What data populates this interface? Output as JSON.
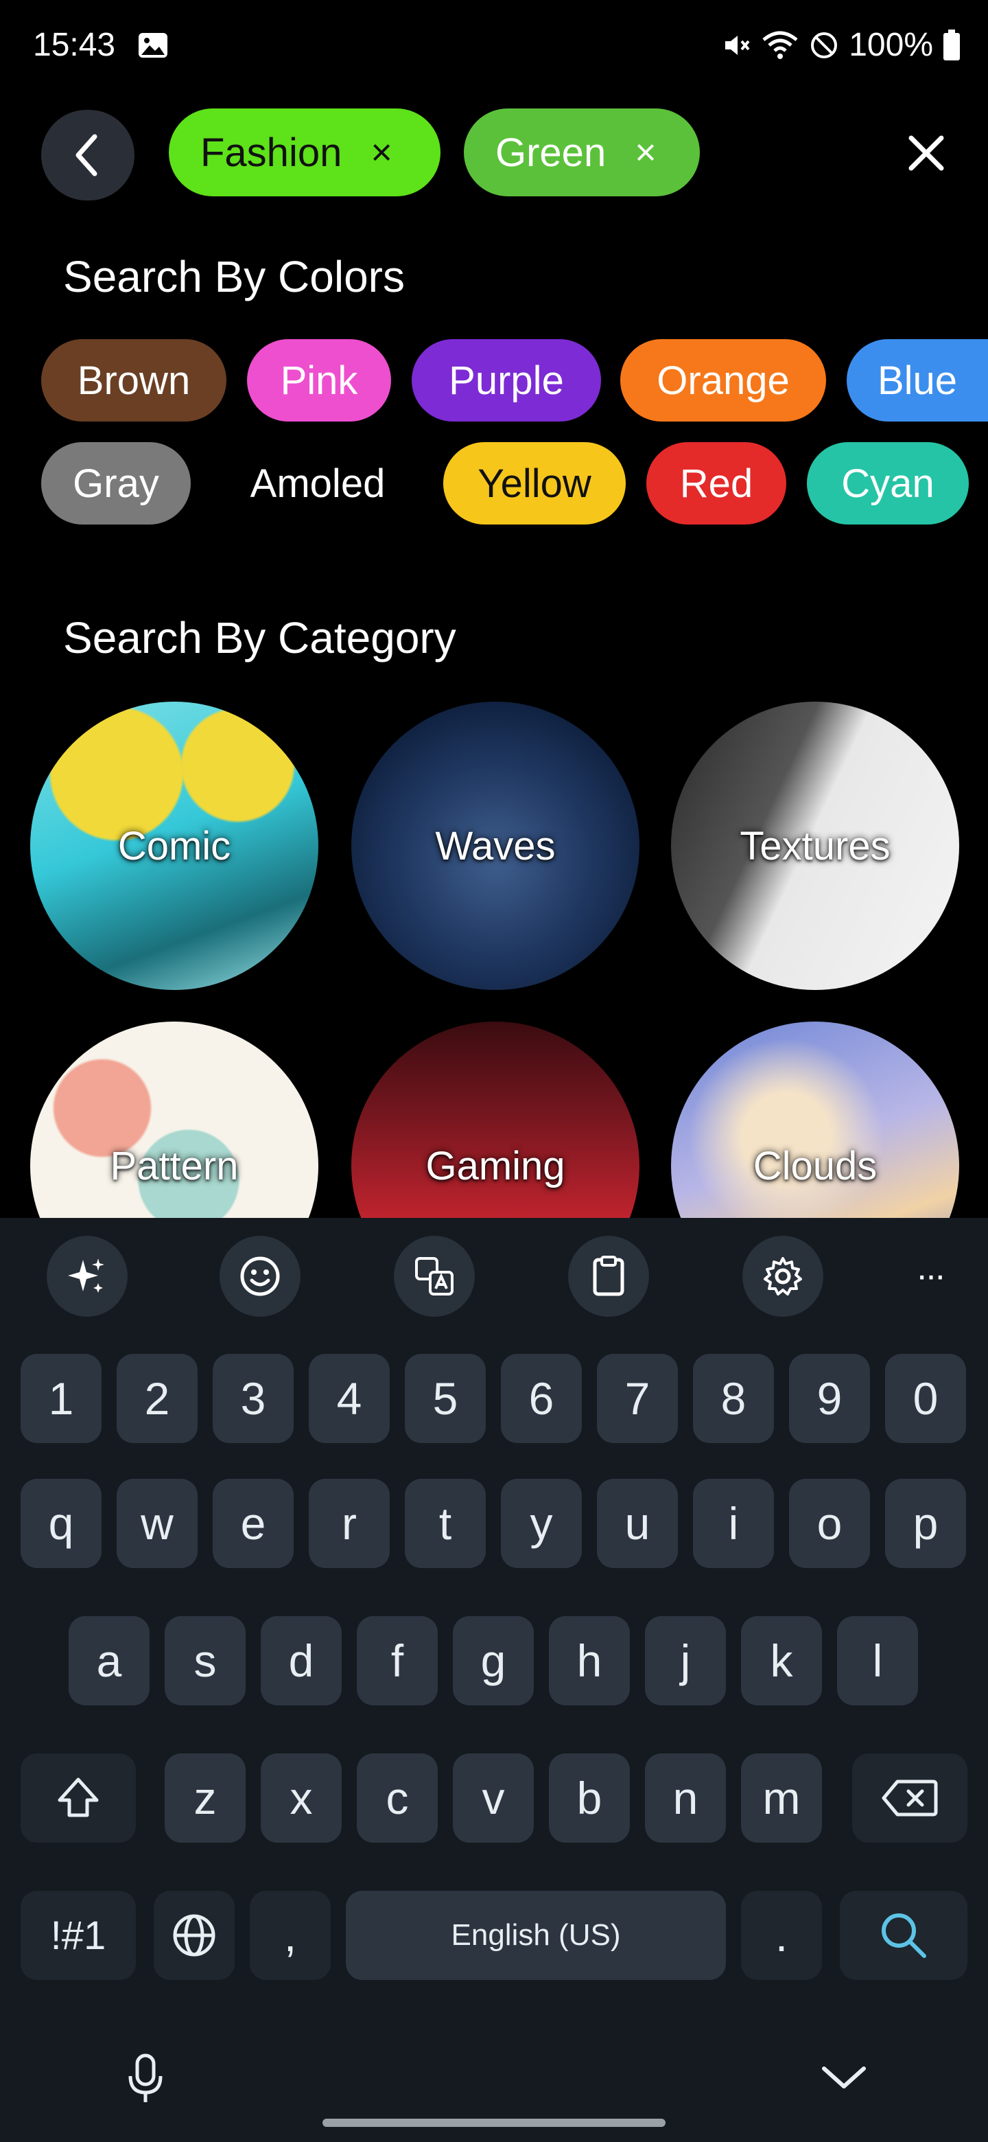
{
  "status_bar": {
    "time": "15:43",
    "battery": "100%"
  },
  "search_header": {
    "chips": [
      {
        "label": "Fashion",
        "remove": "×"
      },
      {
        "label": "Green",
        "remove": "×"
      }
    ],
    "close": "✕"
  },
  "colors_section": {
    "title": "Search By Colors",
    "colors": [
      {
        "label": "Brown",
        "color": "#6a3f24"
      },
      {
        "label": "Pink",
        "color": "#ee4fcf"
      },
      {
        "label": "Purple",
        "color": "#7d2bd4"
      },
      {
        "label": "Orange",
        "color": "#f6781a"
      },
      {
        "label": "Blue",
        "color": "#3c8eee"
      },
      {
        "label": "Gray",
        "color": "#7a7a7a"
      },
      {
        "label": "Amoled",
        "color": "#000000"
      },
      {
        "label": "Yellow",
        "color": "#f7c61b"
      },
      {
        "label": "Red",
        "color": "#e52a2a"
      },
      {
        "label": "Cyan",
        "color": "#25c4a6"
      }
    ]
  },
  "category_section": {
    "title": "Search By Category",
    "categories": [
      "Comic",
      "Waves",
      "Textures",
      "Pattern",
      "Gaming",
      "Clouds"
    ]
  },
  "keyboard": {
    "toolbar_icons": [
      "sparkle-icon",
      "emoji-icon",
      "translate-icon",
      "clipboard-icon",
      "gear-icon",
      "more-icon"
    ],
    "more_label": "···",
    "number_row": [
      "1",
      "2",
      "3",
      "4",
      "5",
      "6",
      "7",
      "8",
      "9",
      "0"
    ],
    "row1": [
      "q",
      "w",
      "e",
      "r",
      "t",
      "y",
      "u",
      "i",
      "o",
      "p"
    ],
    "row2": [
      "a",
      "s",
      "d",
      "f",
      "g",
      "h",
      "j",
      "k",
      "l"
    ],
    "row3": [
      "z",
      "x",
      "c",
      "v",
      "b",
      "n",
      "m"
    ],
    "symbols_key": "!#1",
    "comma_key": ",",
    "space_label": "English (US)",
    "period_key": "."
  }
}
